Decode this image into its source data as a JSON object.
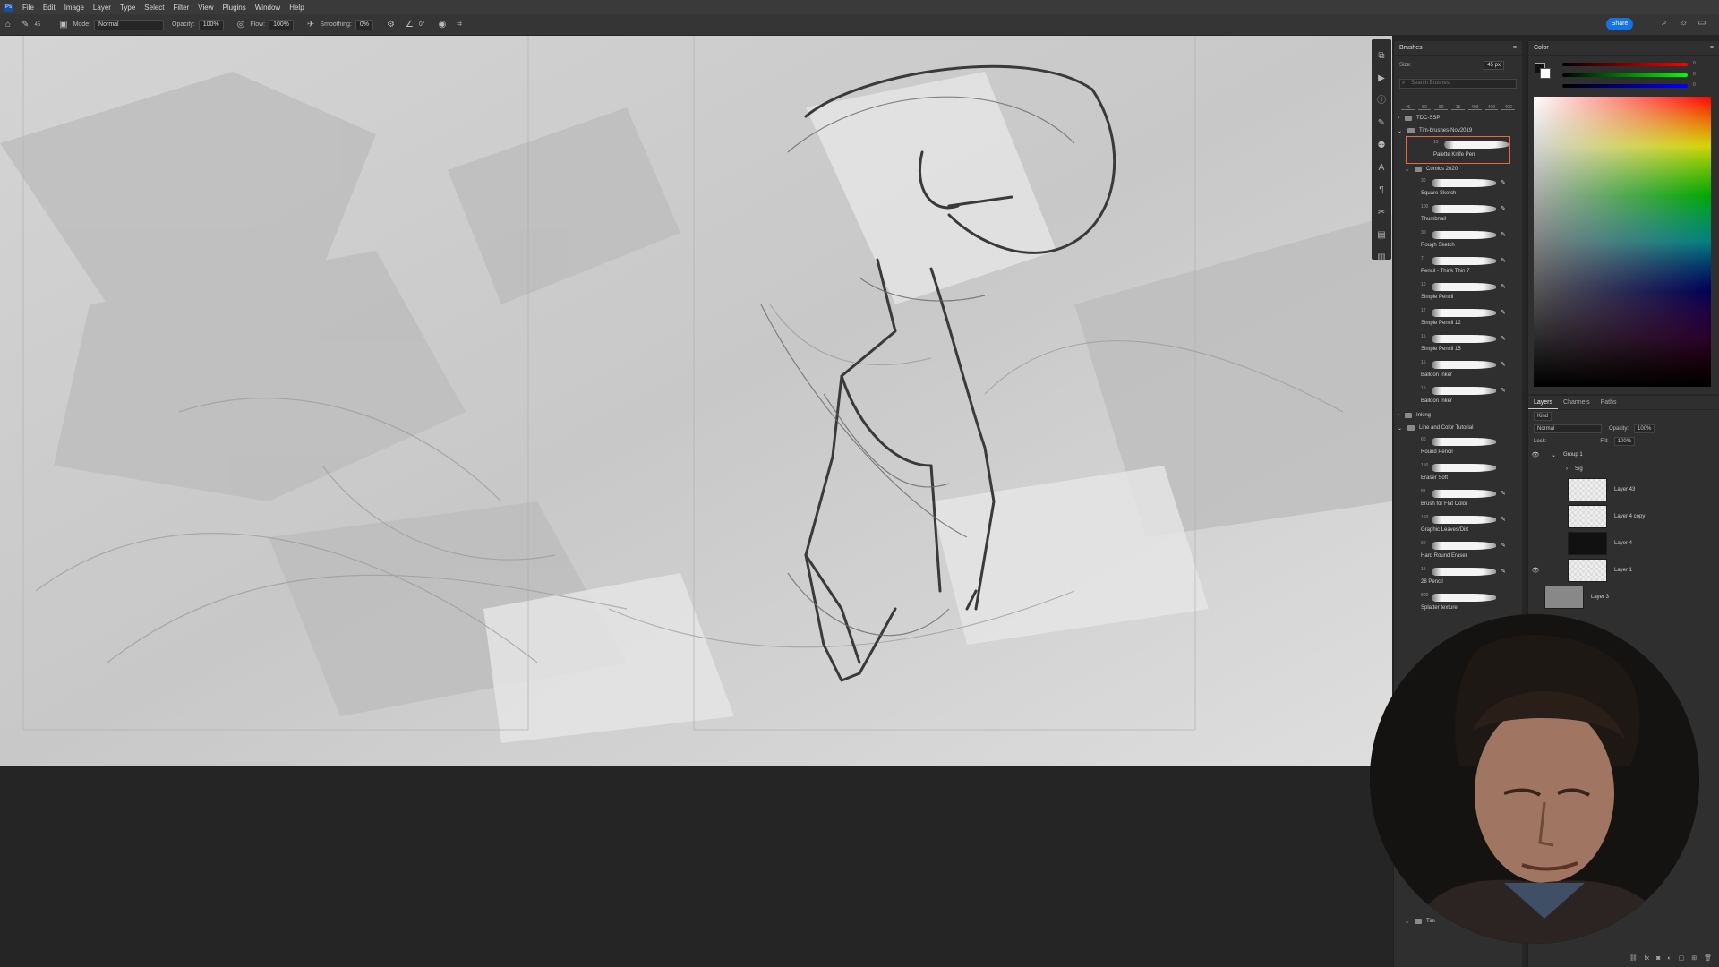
{
  "app": {
    "logo": "Ps"
  },
  "menu": [
    "File",
    "Edit",
    "Image",
    "Layer",
    "Type",
    "Select",
    "Filter",
    "View",
    "Plugins",
    "Window",
    "Help"
  ],
  "options": {
    "brush_size": "45",
    "mode_label": "Mode:",
    "mode_value": "Normal",
    "opacity_label": "Opacity:",
    "opacity_value": "100%",
    "flow_label": "Flow:",
    "flow_value": "100%",
    "smoothing_label": "Smoothing:",
    "smoothing_value": "0%",
    "angle_value": "0°",
    "share_label": "Share"
  },
  "brushes_panel": {
    "title": "Brushes",
    "size_label": "Size:",
    "size_value": "45 px",
    "search_placeholder": "Search Brushes",
    "presets": [
      "45",
      "50",
      "80",
      "15",
      "400",
      "400",
      "400"
    ],
    "folders": {
      "tdc": "TDC-SSP",
      "tim": "Tim-brushes-Nov2019",
      "comics": "Comics 2020",
      "inking": "Inking",
      "line_color": "Line and Color Tutorial",
      "tim2": "Tim"
    },
    "selected_brush": {
      "size": "15",
      "name": "Palette Knife Pen"
    },
    "comics_brushes": [
      {
        "size": "30",
        "name": "Square Sketch"
      },
      {
        "size": "100",
        "name": "Thumbnail"
      },
      {
        "size": "30",
        "name": "Rough Sketch"
      },
      {
        "size": "7",
        "name": "Pencil - Think Thin 7"
      },
      {
        "size": "10",
        "name": "Simple Pencil"
      },
      {
        "size": "12",
        "name": "Simple Pencil 12"
      },
      {
        "size": "15",
        "name": "Simple Pencil 15"
      },
      {
        "size": "15",
        "name": "Balloon Inker"
      },
      {
        "size": "15",
        "name": "Balloon Inker"
      }
    ],
    "tutorial_brushes": [
      {
        "size": "60",
        "name": "Round Pencil"
      },
      {
        "size": "150",
        "name": "Eraser Soft"
      },
      {
        "size": "81",
        "name": "Brush for Flat Color"
      },
      {
        "size": "150",
        "name": "Graphic Leaves/Dirt"
      },
      {
        "size": "60",
        "name": "Hard Round Eraser"
      },
      {
        "size": "15",
        "name": "28 Pencil"
      },
      {
        "size": "800",
        "name": "Splatter texture"
      }
    ]
  },
  "color_panel": {
    "title": "Color",
    "values": [
      "0",
      "0",
      "0"
    ]
  },
  "layers_panel": {
    "tabs": [
      "Layers",
      "Channels",
      "Paths"
    ],
    "filter_label": "Kind",
    "blend_mode": "Normal",
    "opacity_label": "Opacity:",
    "opacity_value": "100%",
    "lock_label": "Lock:",
    "fill_label": "Fill:",
    "fill_value": "100%",
    "group": "Group 1",
    "sig": "Sig",
    "layers": [
      "Layer 43",
      "Layer 4 copy",
      "Layer 4",
      "Layer 1",
      "Layer 3"
    ]
  }
}
